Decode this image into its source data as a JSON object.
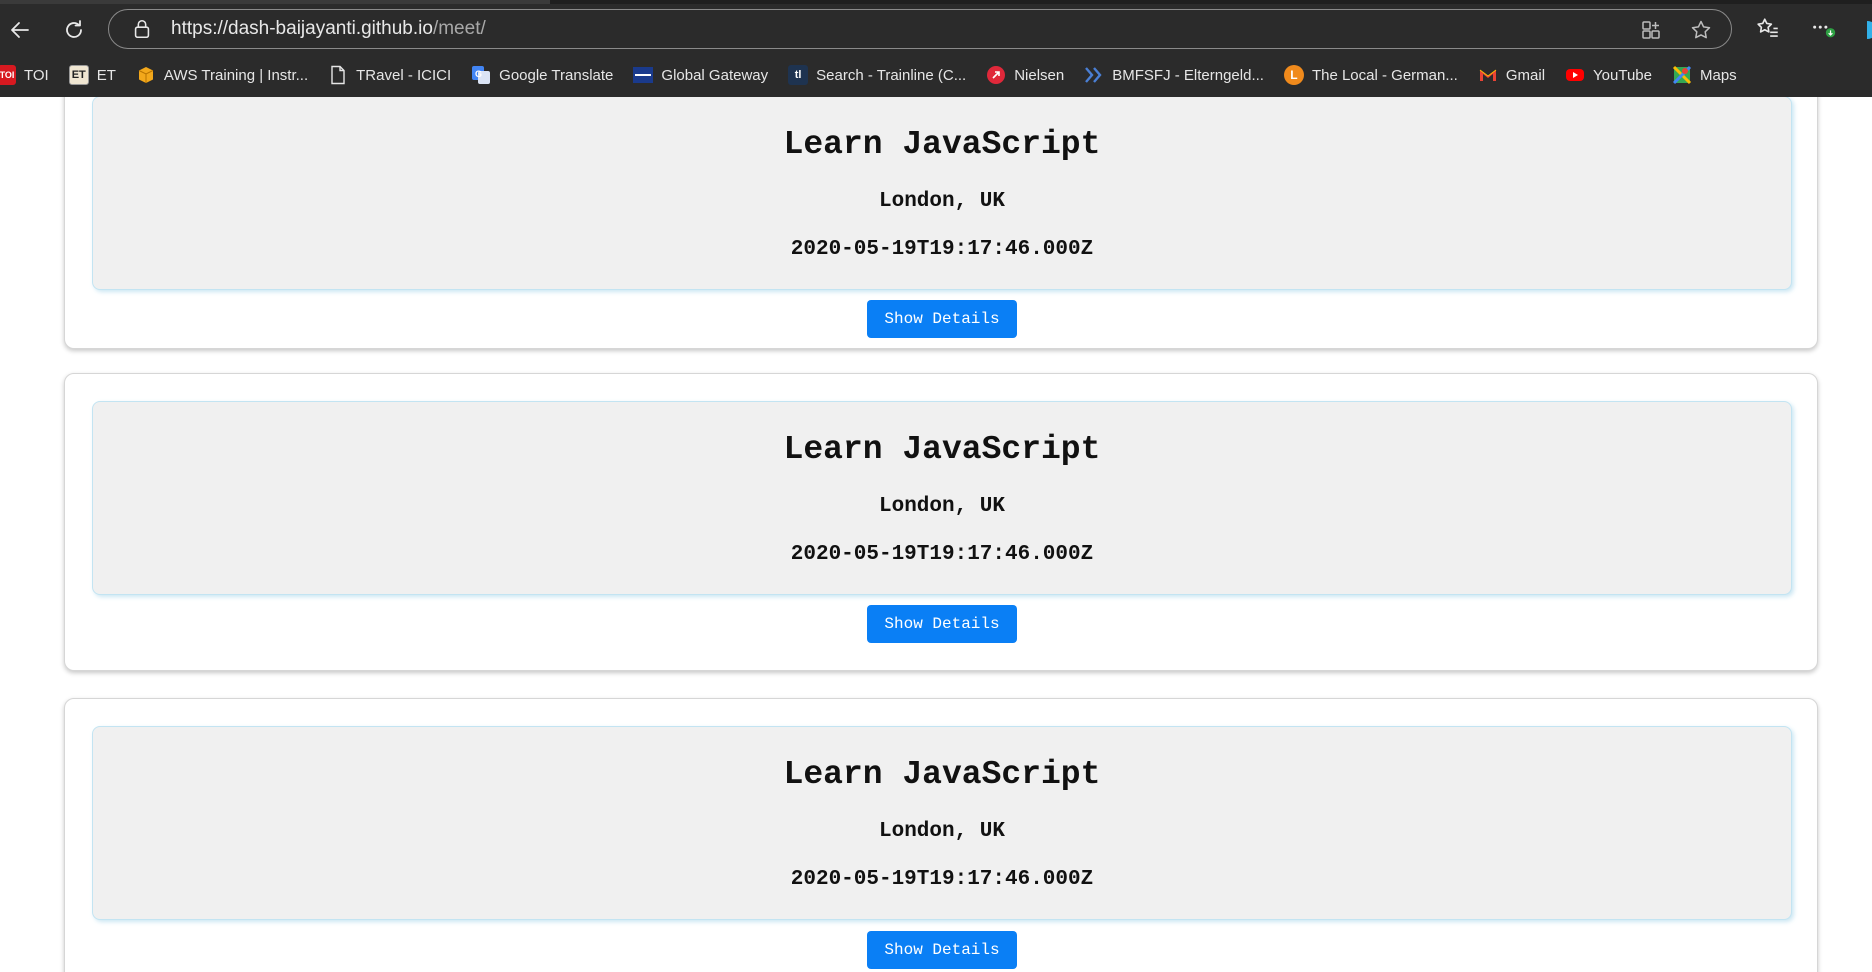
{
  "browser": {
    "url_host": "https://dash-baijayanti.github.io",
    "url_path": "/meet/"
  },
  "bookmarks": [
    {
      "label": "TOI",
      "icon": "toi-icon",
      "badge": "TOI",
      "color": "#d71920"
    },
    {
      "label": "ET",
      "icon": "et-icon",
      "badge": "ET",
      "color": "#f0e6d2"
    },
    {
      "label": "AWS Training | Instr...",
      "icon": "aws-box-icon",
      "color": "#f3a81b"
    },
    {
      "label": "TRavel - ICICI",
      "icon": "document-icon",
      "color": "#e6e6e6"
    },
    {
      "label": "Google Translate",
      "icon": "google-translate-icon",
      "color": "#4285f4"
    },
    {
      "label": "Global Gateway",
      "icon": "zeiss-icon",
      "color": "#1a3a8c"
    },
    {
      "label": "Search - Trainline (C...",
      "icon": "trainline-icon",
      "color": "#1e3350"
    },
    {
      "label": "Nielsen",
      "icon": "nielsen-icon",
      "color": "#e0283a"
    },
    {
      "label": "BMFSFJ - Elterngeld...",
      "icon": "bmfsfj-chevron-icon",
      "color": "#4a7fd4"
    },
    {
      "label": "The Local - German...",
      "icon": "the-local-icon",
      "badge": "L",
      "color": "#f08a1c"
    },
    {
      "label": "Gmail",
      "icon": "gmail-icon",
      "color": "#ea4335"
    },
    {
      "label": "YouTube",
      "icon": "youtube-icon",
      "color": "#ff0000"
    },
    {
      "label": "Maps",
      "icon": "google-maps-icon",
      "color": "#34a853"
    }
  ],
  "events": [
    {
      "title": "Learn JavaScript",
      "location": "London, UK",
      "start": "2020-05-19T19:17:46.000Z",
      "button": "Show Details"
    },
    {
      "title": "Learn JavaScript",
      "location": "London, UK",
      "start": "2020-05-19T19:17:46.000Z",
      "button": "Show Details"
    },
    {
      "title": "Learn JavaScript",
      "location": "London, UK",
      "start": "2020-05-19T19:17:46.000Z",
      "button": "Show Details"
    }
  ],
  "colors": {
    "chrome_bg": "#2b2b2b",
    "button_blue": "#0a7ff5",
    "card_inner_bg": "#f0f0f0",
    "card_inner_border": "#c3e4f2"
  }
}
